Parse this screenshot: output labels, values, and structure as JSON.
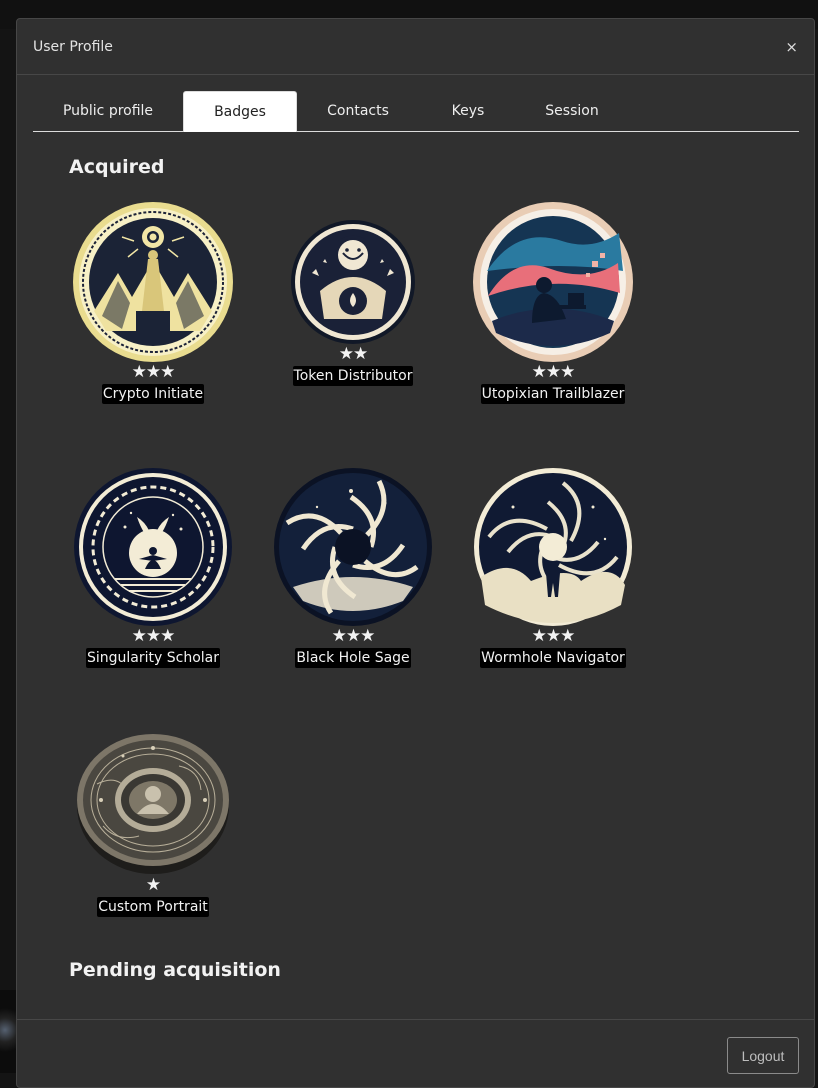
{
  "modal": {
    "title": "User Profile",
    "close": "×"
  },
  "tabs": [
    {
      "label": "Public profile",
      "active": false
    },
    {
      "label": "Badges",
      "active": true
    },
    {
      "label": "Contacts",
      "active": false
    },
    {
      "label": "Keys",
      "active": false
    },
    {
      "label": "Session",
      "active": false
    }
  ],
  "sections": {
    "acquired": "Acquired",
    "pending": "Pending acquisition"
  },
  "badges": [
    {
      "name": "Crypto Initiate",
      "stars": "★★★",
      "icon": "crypto-initiate-icon"
    },
    {
      "name": "Token Distributor",
      "stars": "★★",
      "icon": "token-distributor-icon"
    },
    {
      "name": "Utopixian Trailblazer",
      "stars": "★★★",
      "icon": "utopixian-trailblazer-icon"
    },
    {
      "name": "Singularity Scholar",
      "stars": "★★★",
      "icon": "singularity-scholar-icon"
    },
    {
      "name": "Black Hole Sage",
      "stars": "★★★",
      "icon": "black-hole-sage-icon"
    },
    {
      "name": "Wormhole Navigator",
      "stars": "★★★",
      "icon": "wormhole-navigator-icon"
    },
    {
      "name": "Custom Portrait",
      "stars": "★",
      "icon": "custom-portrait-icon"
    }
  ],
  "footer": {
    "logout": "Logout"
  },
  "colors": {
    "modal_bg": "#303030",
    "border": "#474747",
    "badge_cream": "#f1ead0",
    "badge_navy": "#0f1a33"
  }
}
